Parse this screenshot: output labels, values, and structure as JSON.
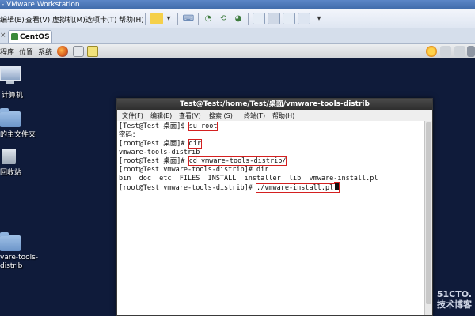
{
  "vmware": {
    "title": "- VMware Workstation",
    "menus": [
      "编辑(E)",
      "查看(V)",
      "虚拟机(M)",
      "选项卡(T)",
      "帮助(H)"
    ],
    "tab_label": "CentOS",
    "tab_close": "×"
  },
  "gnome_panel": {
    "menus": [
      "程序",
      "位置",
      "系统"
    ]
  },
  "desktop": {
    "icons": [
      {
        "label": "计算机"
      },
      {
        "label": "的主文件夹"
      },
      {
        "label": "回收站"
      },
      {
        "label": "vare-tools-",
        "label2": "distrib"
      }
    ]
  },
  "terminal": {
    "title": "Test@Test:/home/Test/桌面/vmware-tools-distrib",
    "menus": [
      "文件(F)",
      "编辑(E)",
      "查看(V)",
      "搜索 (S)",
      "终端(T)",
      "帮助(H)"
    ],
    "lines": [
      {
        "prefix": "[Test@Test 桌面]$ ",
        "cmd": "su root"
      },
      {
        "prefix": "密码：",
        "cmd": ""
      },
      {
        "prefix": "[root@Test 桌面]# ",
        "cmd": "dir"
      },
      {
        "prefix": "vmware-tools-distrib",
        "cmd": ""
      },
      {
        "prefix": "[root@Test 桌面]# ",
        "cmd": "cd vmware-tools-distrib/"
      },
      {
        "prefix": "[root@Test vmware-tools-distrib]# dir",
        "cmd": ""
      },
      {
        "prefix": "bin  doc  etc  FILES  INSTALL  installer  lib  vmware-install.pl",
        "cmd": ""
      },
      {
        "prefix": "[root@Test vmware-tools-distrib]# ",
        "cmd": "./vmware-install.pl"
      }
    ]
  },
  "watermark": {
    "line1": "51CTO.",
    "line2": "技术博客"
  }
}
